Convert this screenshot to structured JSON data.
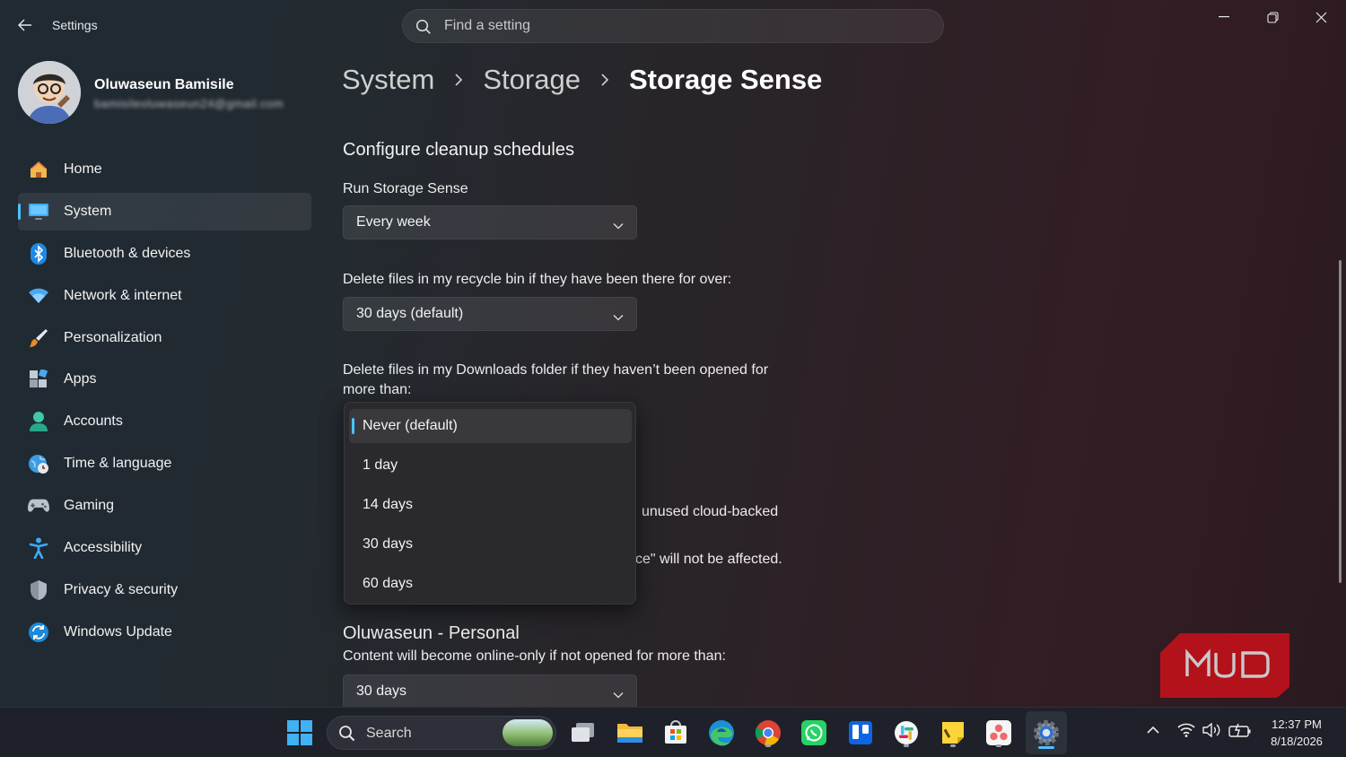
{
  "window": {
    "app_title": "Settings"
  },
  "search": {
    "placeholder": "Find a setting"
  },
  "profile": {
    "name": "Oluwaseun Bamisile",
    "email": "bamisileoluwaseun24@gmail.com"
  },
  "sidebar": {
    "items": [
      {
        "label": "Home",
        "icon": "home-icon"
      },
      {
        "label": "System",
        "icon": "monitor-icon",
        "active": true
      },
      {
        "label": "Bluetooth & devices",
        "icon": "bluetooth-icon"
      },
      {
        "label": "Network & internet",
        "icon": "wifi-icon"
      },
      {
        "label": "Personalization",
        "icon": "brush-icon"
      },
      {
        "label": "Apps",
        "icon": "apps-icon"
      },
      {
        "label": "Accounts",
        "icon": "person-icon"
      },
      {
        "label": "Time & language",
        "icon": "globe-clock-icon"
      },
      {
        "label": "Gaming",
        "icon": "gamepad-icon"
      },
      {
        "label": "Accessibility",
        "icon": "accessibility-icon"
      },
      {
        "label": "Privacy & security",
        "icon": "shield-icon"
      },
      {
        "label": "Windows Update",
        "icon": "update-icon"
      }
    ]
  },
  "breadcrumb": {
    "items": [
      "System",
      "Storage",
      "Storage Sense"
    ]
  },
  "content": {
    "section_title": "Configure cleanup schedules",
    "run_label": "Run Storage Sense",
    "run_value": "Every week",
    "recycle_label": "Delete files in my recycle bin if they have been there for over:",
    "recycle_value": "30 days (default)",
    "downloads_label": "Delete files in my Downloads folder if they haven’t been opened for more than:",
    "obscured_text_1": "unused cloud-backed",
    "obscured_text_2": "ce\" will not be affected.",
    "onedrive_title": "Oluwaseun - Personal",
    "onedrive_label": "Content will become online-only if not opened for more than:",
    "onedrive_value": "30 days"
  },
  "downloads_dropdown": {
    "options": [
      "Never (default)",
      "1 day",
      "14 days",
      "30 days",
      "60 days"
    ],
    "selected": "Never (default)"
  },
  "watermark": {
    "text": "MUO",
    "color": "#b3121b"
  },
  "taskbar": {
    "search_label": "Search",
    "apps": [
      "start-icon",
      "task-view-icon",
      "file-explorer-icon",
      "store-icon",
      "edge-icon",
      "chrome-icon",
      "whatsapp-icon",
      "trello-icon",
      "slack-icon",
      "sticky-notes-icon",
      "asana-icon",
      "settings-icon"
    ],
    "time": "12:37 PM",
    "date": "8/18/2026"
  },
  "colors": {
    "accent": "#4cc2ff"
  }
}
